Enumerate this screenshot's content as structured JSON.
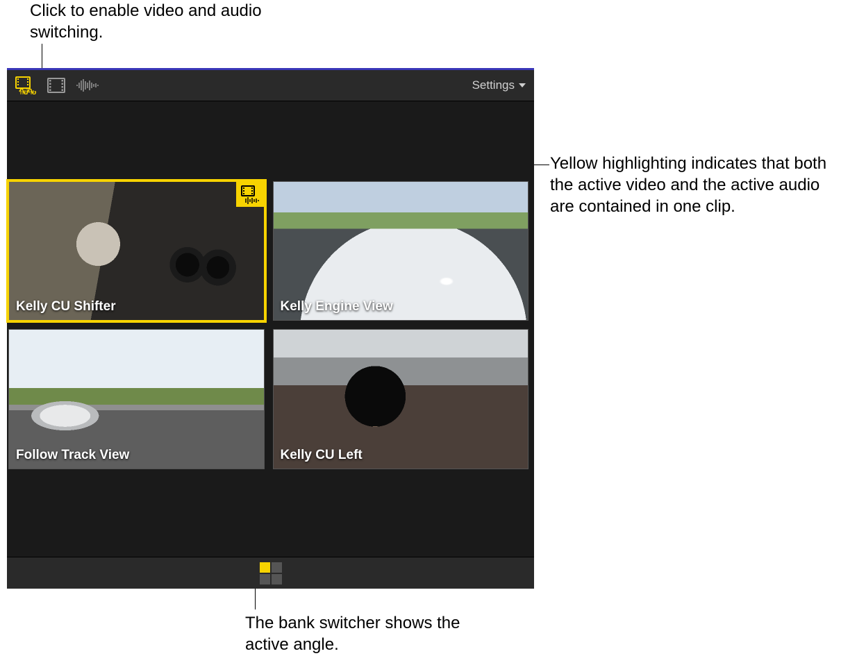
{
  "callouts": {
    "top": "Click to enable video and audio switching.",
    "right": "Yellow highlighting indicates that both the active video and the active audio are contained in one clip.",
    "bottom": "The bank switcher shows the active angle."
  },
  "toolbar": {
    "modes": {
      "video_audio": "video-audio-switching-icon",
      "video_only": "video-only-switching-icon",
      "audio_only": "audio-only-switching-icon"
    },
    "settings_label": "Settings"
  },
  "colors": {
    "accent": "#f7d300",
    "window_accent": "#3a37b8"
  },
  "angles": [
    {
      "label": "Kelly CU Shifter",
      "active": true,
      "badge": "film-waveform-icon"
    },
    {
      "label": "Kelly Engine View",
      "active": false
    },
    {
      "label": "Follow Track View",
      "active": false
    },
    {
      "label": "Kelly CU Left",
      "active": false
    }
  ],
  "bank": {
    "cells": [
      true,
      false,
      false,
      false
    ]
  }
}
